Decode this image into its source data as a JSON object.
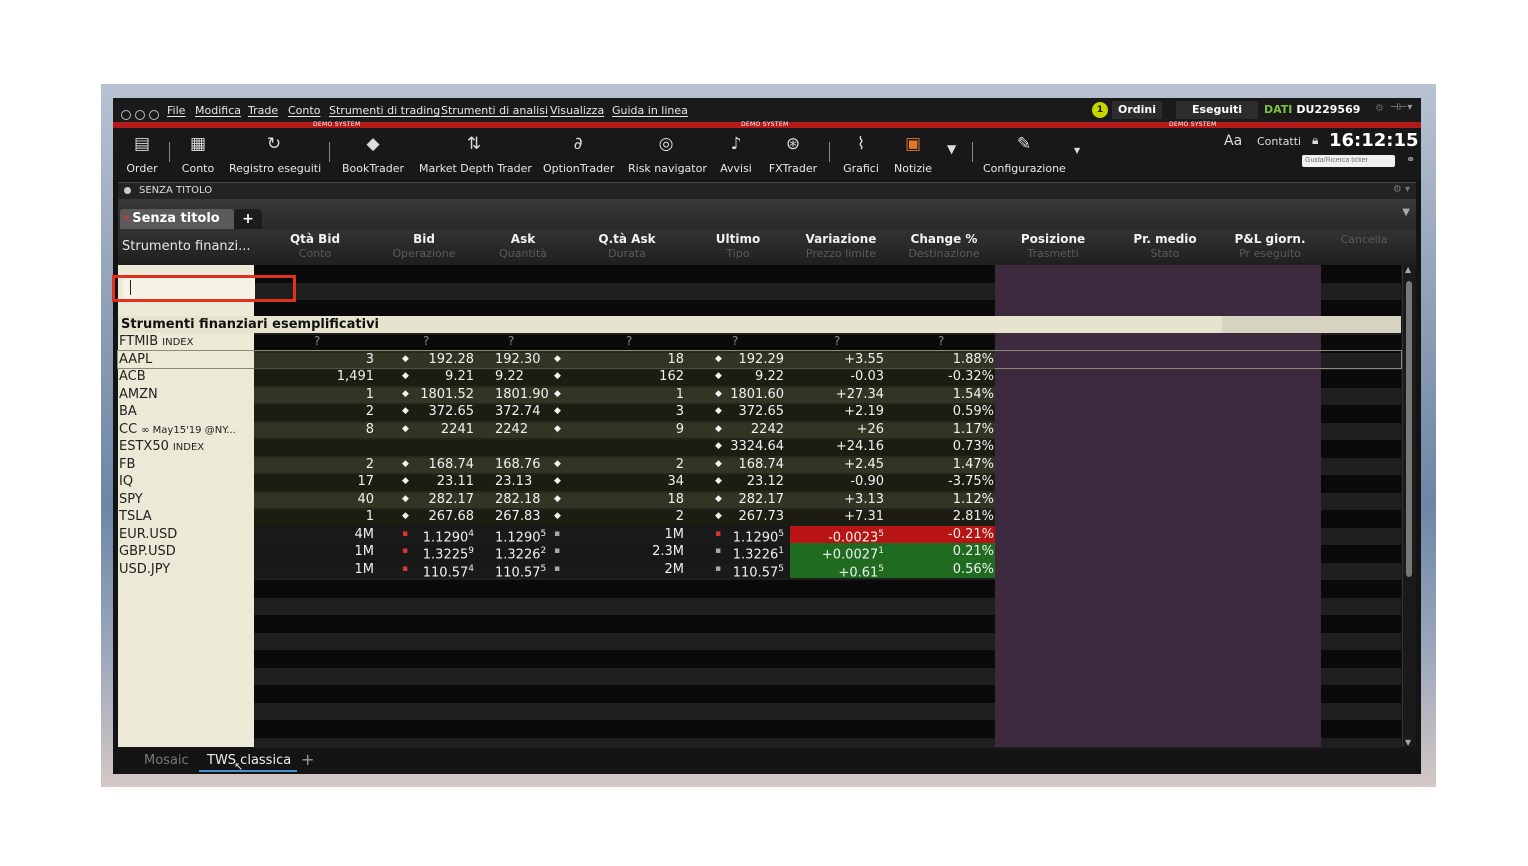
{
  "menubar": {
    "items": [
      "File",
      "Modifica",
      "Trade",
      "Conto",
      "Strumenti di trading",
      "Strumenti di analisi",
      "Visualizza",
      "Guida in linea"
    ],
    "orders_badge": "1",
    "orders_label": "Ordini",
    "executed_label": "Eseguiti",
    "data_label": "DATI",
    "account": "DU229569",
    "demo_label": "DEMO SYSTEM"
  },
  "toolbar": {
    "items": [
      {
        "label": "Order",
        "icon": "order-icon"
      },
      {
        "label": "Conto",
        "icon": "account-icon"
      },
      {
        "label": "Registro eseguiti",
        "icon": "trade-log-icon"
      },
      {
        "label": "BookTrader",
        "icon": "booktrader-icon"
      },
      {
        "label": "Market Depth Trader",
        "icon": "market-depth-icon"
      },
      {
        "label": "OptionTrader",
        "icon": "option-trader-icon"
      },
      {
        "label": "Risk navigator",
        "icon": "risk-navigator-icon"
      },
      {
        "label": "Avvisi",
        "icon": "alerts-icon"
      },
      {
        "label": "FXTrader",
        "icon": "fx-trader-icon"
      },
      {
        "label": "Grafici",
        "icon": "charts-icon"
      },
      {
        "label": "Notizie",
        "icon": "news-icon"
      },
      {
        "label": "Configurazione",
        "icon": "config-icon"
      }
    ],
    "font_label": "Aa",
    "contacts_label": "Contatti",
    "clock": "16:12:15",
    "ticker_placeholder": "Guida/Ricerca ticker"
  },
  "panel": {
    "title": "SENZA TITOLO",
    "tab_label": "Senza titolo",
    "tab_add": "+"
  },
  "columns": {
    "first": "Strumento finanzi...",
    "headers": [
      {
        "label": "Qtà Bid",
        "sub": "Conto"
      },
      {
        "label": "Bid",
        "sub": "Operazione"
      },
      {
        "label": "Ask",
        "sub": "Quantità"
      },
      {
        "label": "Q.tà Ask",
        "sub": "Durata"
      },
      {
        "label": "Ultimo",
        "sub": "Tipo"
      },
      {
        "label": "Variazione",
        "sub": "Prezzo limite"
      },
      {
        "label": "Change %",
        "sub": "Destinazione"
      },
      {
        "label": "Posizione",
        "sub": "Trasmetti"
      },
      {
        "label": "Pr. medio",
        "sub": "Stato"
      },
      {
        "label": "P&L giorn.",
        "sub": "Pr eseguito"
      },
      {
        "label": "",
        "sub": "Cancella"
      }
    ]
  },
  "group_label": "Strumenti finanziari esemplificativi",
  "rows": [
    {
      "sym": "FTMIB",
      "tag": "INDEX",
      "bidsize": "?",
      "bid": "?",
      "ask": "?",
      "asksize": "?",
      "last": "?",
      "chg": "?",
      "pct": "?",
      "q": true
    },
    {
      "sym": "AAPL",
      "bidsize": "3",
      "bid": "192.28",
      "ask": "192.30",
      "asksize": "18",
      "last": "192.29",
      "chg": "+3.55",
      "pct": "1.88%",
      "sel": true
    },
    {
      "sym": "ACB",
      "bidsize": "1,491",
      "bid": "9.21",
      "ask": "9.22",
      "asksize": "162",
      "last": "9.22",
      "chg": "-0.03",
      "pct": "-0.32%"
    },
    {
      "sym": "AMZN",
      "bidsize": "1",
      "bid": "1801.52",
      "ask": "1801.90",
      "asksize": "1",
      "last": "1801.60",
      "chg": "+27.34",
      "pct": "1.54%"
    },
    {
      "sym": "BA",
      "bidsize": "2",
      "bid": "372.65",
      "ask": "372.74",
      "asksize": "3",
      "last": "372.65",
      "chg": "+2.19",
      "pct": "0.59%"
    },
    {
      "sym": "CC",
      "tag": "∞ May15'19 @NY...",
      "bidsize": "8",
      "bid": "2241",
      "ask": "2242",
      "asksize": "9",
      "last": "2242",
      "chg": "+26",
      "pct": "1.17%"
    },
    {
      "sym": "ESTX50",
      "tag": "INDEX",
      "bidsize": "",
      "bid": "",
      "ask": "",
      "asksize": "",
      "last": "3324.64",
      "chg": "+24.16",
      "pct": "0.73%"
    },
    {
      "sym": "FB",
      "bidsize": "2",
      "bid": "168.74",
      "ask": "168.76",
      "asksize": "2",
      "last": "168.74",
      "chg": "+2.45",
      "pct": "1.47%"
    },
    {
      "sym": "IQ",
      "bidsize": "17",
      "bid": "23.11",
      "ask": "23.13",
      "asksize": "34",
      "last": "23.12",
      "chg": "-0.90",
      "pct": "-3.75%"
    },
    {
      "sym": "SPY",
      "bidsize": "40",
      "bid": "282.17",
      "ask": "282.18",
      "asksize": "18",
      "last": "282.17",
      "chg": "+3.13",
      "pct": "1.12%"
    },
    {
      "sym": "TSLA",
      "bidsize": "1",
      "bid": "267.68",
      "ask": "267.83",
      "asksize": "2",
      "last": "267.73",
      "chg": "+7.31",
      "pct": "2.81%"
    },
    {
      "sym": "EUR.USD",
      "bidsize": "4M",
      "bid": "1.1290",
      "bidp": "4",
      "ask": "1.1290",
      "askp": "5",
      "asksize": "1M",
      "last": "1.1290",
      "lastp": "5",
      "chg": "-0.0023",
      "chgp": "5",
      "pct": "-0.21%",
      "fx": "neg"
    },
    {
      "sym": "GBP.USD",
      "bidsize": "1M",
      "bid": "1.3225",
      "bidp": "9",
      "ask": "1.3226",
      "askp": "2",
      "asksize": "2.3M",
      "last": "1.3226",
      "lastp": "1",
      "chg": "+0.0027",
      "chgp": "1",
      "pct": "0.21%",
      "fx": "pos"
    },
    {
      "sym": "USD.JPY",
      "bidsize": "1M",
      "bid": "110.57",
      "bidp": "4",
      "ask": "110.57",
      "askp": "5",
      "asksize": "2M",
      "last": "110.57",
      "lastp": "5",
      "chg": "+0.61",
      "chgp": "5",
      "pct": "0.56%",
      "fx": "pos"
    }
  ],
  "bottom_tabs": [
    "Mosaic",
    "TWS classica"
  ],
  "bottom_add": "+",
  "colors": {
    "positive": "#1f6b1f",
    "negative": "#b81414",
    "purple_area": "#3e2a3e",
    "symbol_col": "#ecead6"
  }
}
